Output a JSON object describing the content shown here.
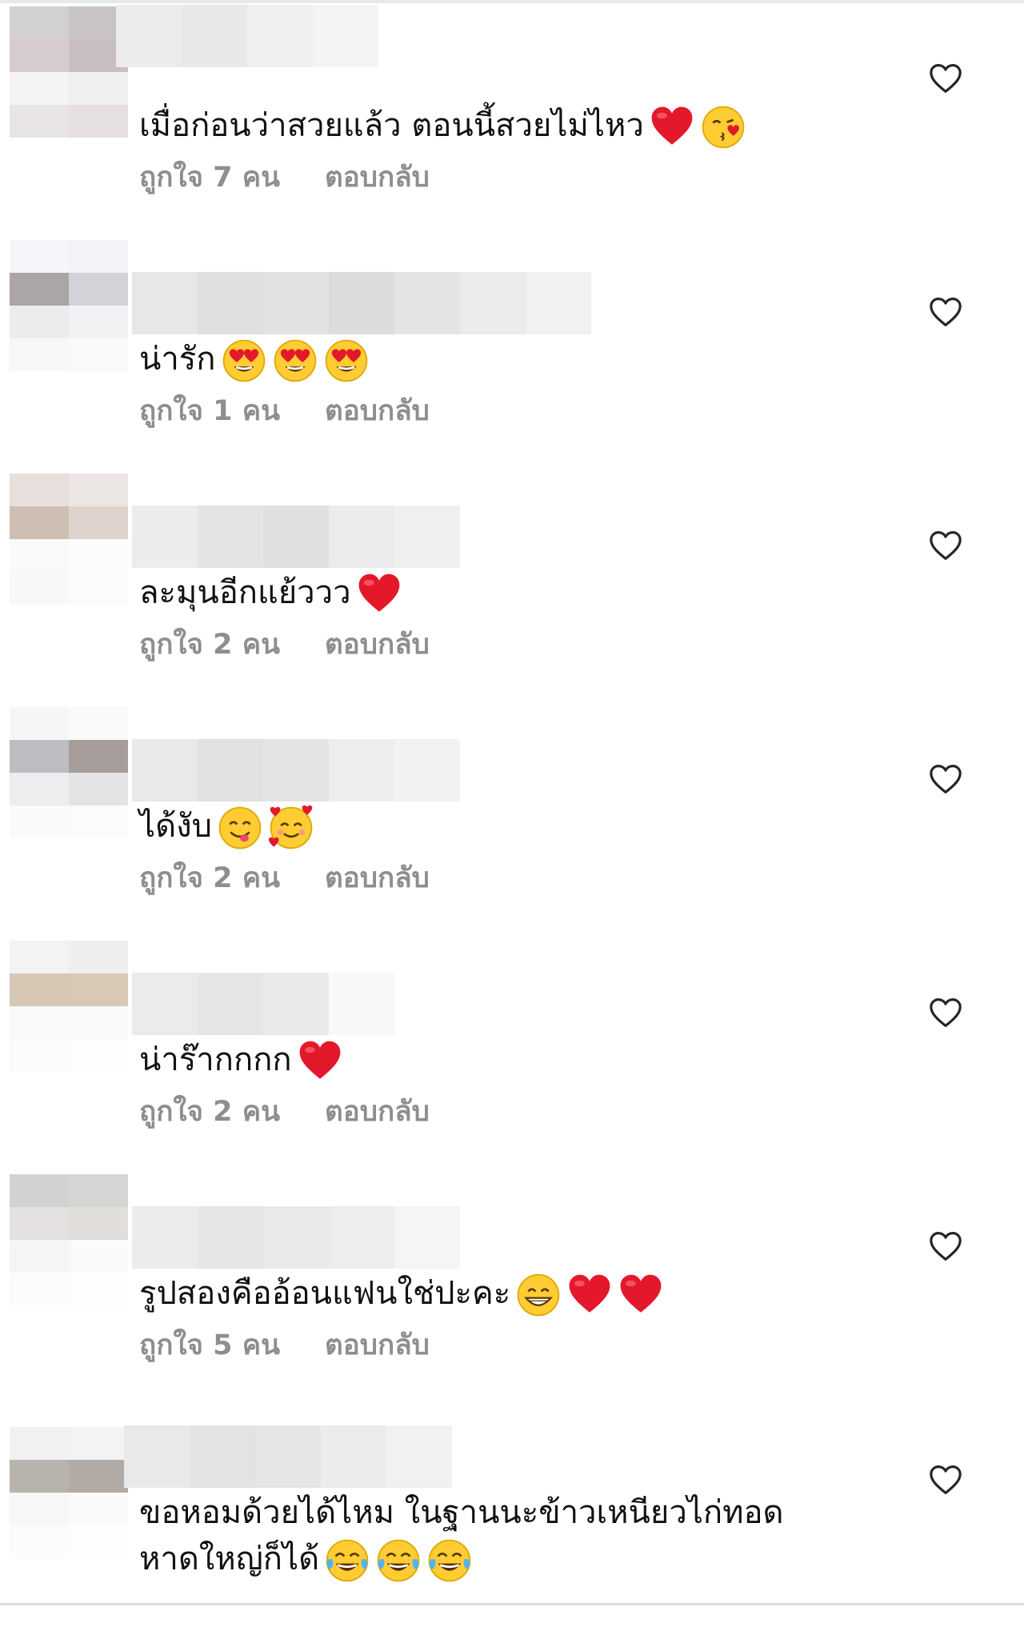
{
  "comments": [
    {
      "text": "เมื่อก่อนว่าสวยแล้ว ตอนนี้สวยไม่ไหว",
      "emojis": [
        "red-heart",
        "face-blowing-kiss"
      ],
      "likes": "ถูกใจ 7 คน",
      "reply": "ตอบกลับ"
    },
    {
      "text": "น่ารัก",
      "emojis": [
        "heart-eyes-face",
        "heart-eyes-face",
        "heart-eyes-face"
      ],
      "likes": "ถูกใจ 1 คน",
      "reply": "ตอบกลับ"
    },
    {
      "text": "ละมุนอีกแย้ววว",
      "emojis": [
        "red-heart"
      ],
      "likes": "ถูกใจ 2 คน",
      "reply": "ตอบกลับ"
    },
    {
      "text": "ได้งับ",
      "emojis": [
        "smiling-face-yum",
        "smiling-face-with-hearts"
      ],
      "likes": "ถูกใจ 2 คน",
      "reply": "ตอบกลับ"
    },
    {
      "text": "น่าร๊ากกกก",
      "emojis": [
        "red-heart"
      ],
      "likes": "ถูกใจ 2 คน",
      "reply": "ตอบกลับ"
    },
    {
      "text": "รูปสองคืออ้อนแฟนใช่ปะคะ",
      "emojis": [
        "grinning-face",
        "red-heart",
        "red-heart"
      ],
      "likes": "ถูกใจ 5 คน",
      "reply": "ตอบกลับ"
    },
    {
      "text": "ขอหอมด้วยได้ไหม ในฐานนะข้าวเหนียวไก่ทอด หาดใหญ่ก็ได้",
      "emojis": [
        "tears-of-joy-face",
        "tears-of-joy-face",
        "tears-of-joy-face"
      ],
      "likes": "",
      "reply": ""
    }
  ],
  "icons": {
    "like": "heart-outline-icon"
  },
  "colors": {
    "text": "#111111",
    "meta": "#8e8e8e",
    "heart_outline": "#262626"
  }
}
